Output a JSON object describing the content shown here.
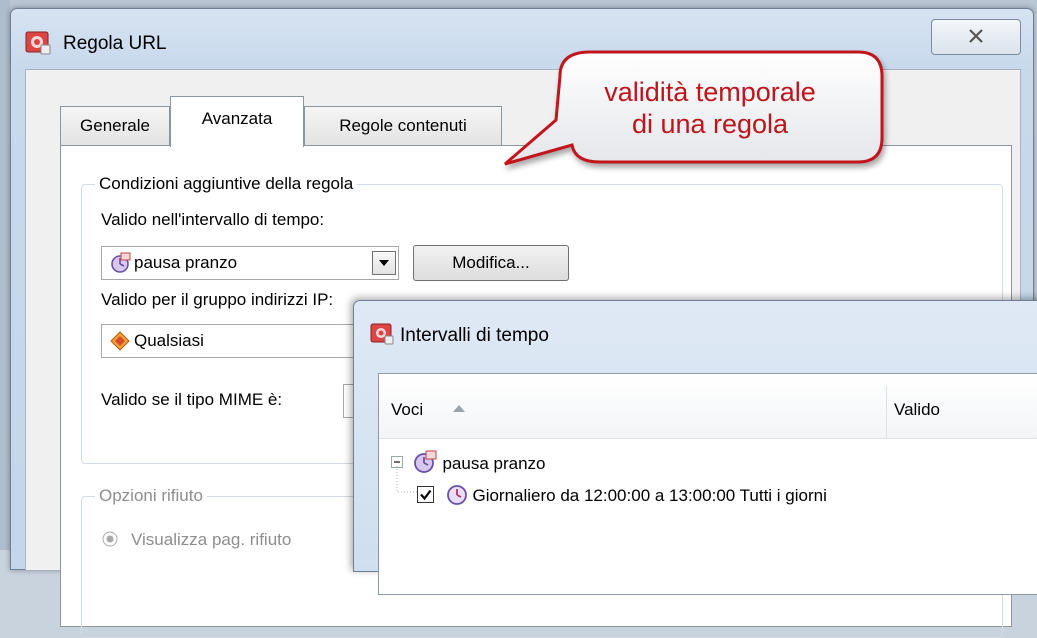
{
  "main_window": {
    "title": "Regola URL",
    "tabs": [
      {
        "label": "Generale"
      },
      {
        "label": "Avanzata"
      },
      {
        "label": "Regole contenuti"
      }
    ],
    "group_conditions": {
      "legend": "Condizioni aggiuntive della regola",
      "time_label": "Valido nell'intervallo di tempo:",
      "time_value": "pausa pranzo",
      "edit_button": "Modifica...",
      "ip_label": "Valido per il gruppo indirizzi IP:",
      "ip_value": "Qualsiasi",
      "mime_label": "Valido se il tipo MIME è:"
    },
    "group_reject": {
      "legend": "Opzioni rifiuto",
      "radio_label": "Visualizza pag. rifiuto"
    }
  },
  "callout": {
    "line1": "validità temporale",
    "line2": "di una regola",
    "color": "#c0141b"
  },
  "intervals_window": {
    "title": "Intervalli di tempo",
    "columns": [
      "Voci",
      "Valido"
    ],
    "tree": {
      "parent": "pausa pranzo",
      "child": "Giornaliero da 12:00:00 a 13:00:00 Tutti i giorni",
      "child_checked": true
    }
  },
  "icons": [
    "app-icon",
    "close-icon",
    "schedule-icon",
    "ip-group-icon",
    "clock-icon",
    "checkbox-icon",
    "tree-collapse-icon"
  ]
}
